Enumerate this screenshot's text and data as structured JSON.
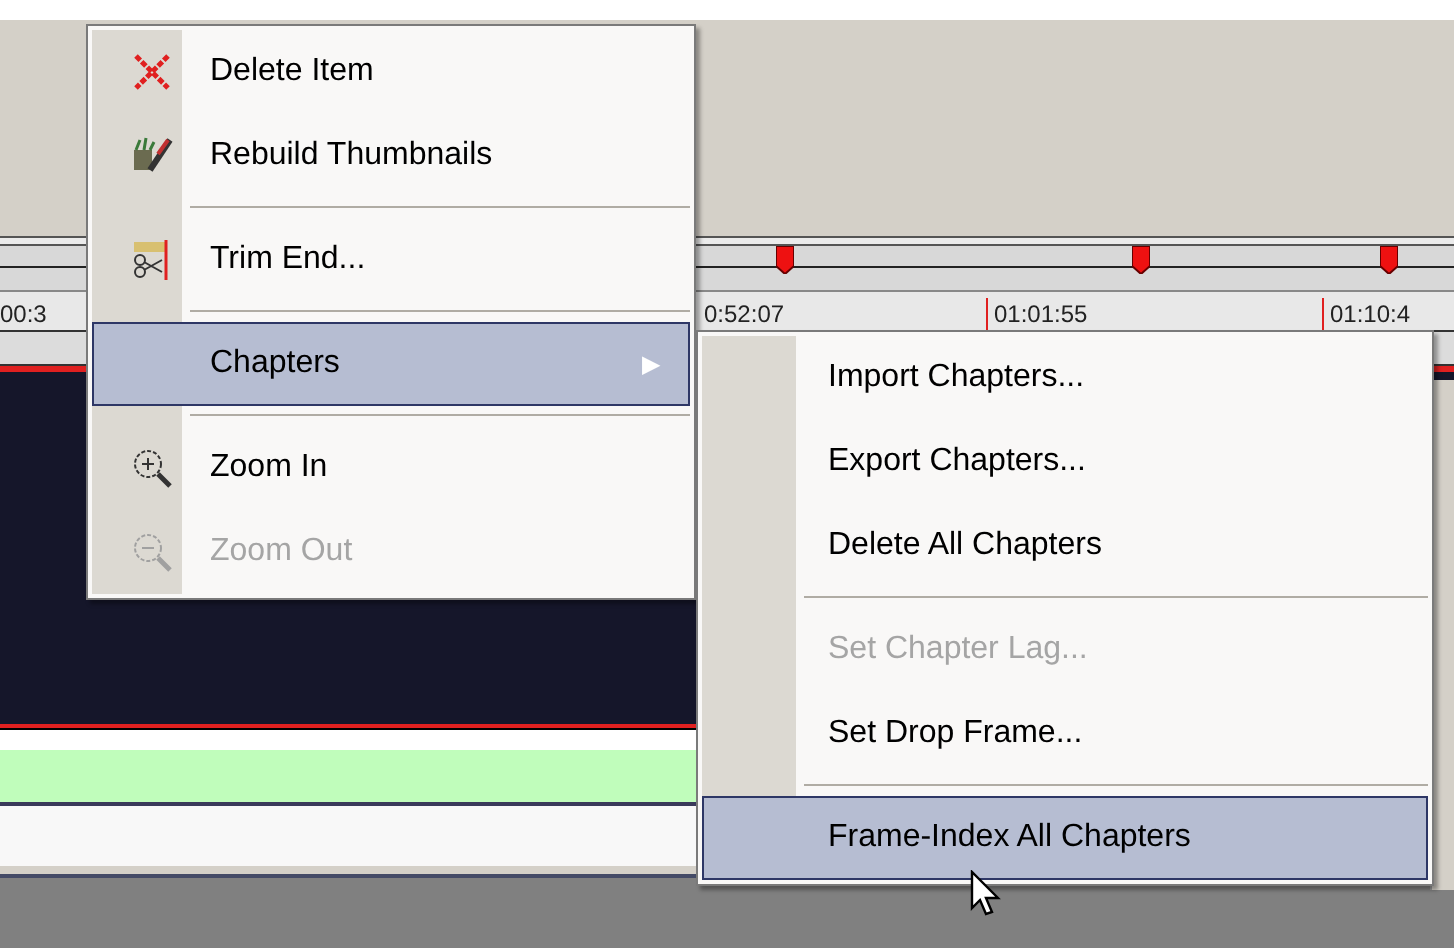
{
  "timeline": {
    "ruler_labels": [
      "00:3",
      "0:52:07",
      "01:01:55",
      "01:10:4"
    ]
  },
  "context_menu": {
    "items": [
      {
        "kind": "item",
        "label": "Delete Item",
        "disabled": false,
        "selected": false
      },
      {
        "kind": "item",
        "label": "Rebuild Thumbnails",
        "disabled": false,
        "selected": false
      },
      {
        "kind": "separator"
      },
      {
        "kind": "item",
        "label": "Trim End...",
        "disabled": false,
        "selected": false
      },
      {
        "kind": "separator"
      },
      {
        "kind": "submenu",
        "label": "Chapters",
        "arrow": "▶",
        "disabled": false,
        "selected": true
      },
      {
        "kind": "separator"
      },
      {
        "kind": "item",
        "label": "Zoom In",
        "disabled": false,
        "selected": false
      },
      {
        "kind": "item",
        "label": "Zoom Out",
        "disabled": true,
        "selected": false
      }
    ]
  },
  "submenu": {
    "items": [
      {
        "kind": "item",
        "label": "Import Chapters...",
        "disabled": false,
        "selected": false
      },
      {
        "kind": "item",
        "label": "Export Chapters...",
        "disabled": false,
        "selected": false
      },
      {
        "kind": "item",
        "label": "Delete All Chapters",
        "disabled": false,
        "selected": false
      },
      {
        "kind": "separator"
      },
      {
        "kind": "item",
        "label": "Set Chapter Lag...",
        "disabled": true,
        "selected": false
      },
      {
        "kind": "item",
        "label": "Set Drop Frame...",
        "disabled": false,
        "selected": false
      },
      {
        "kind": "separator"
      },
      {
        "kind": "item",
        "label": "Frame-Index All Chapters",
        "disabled": false,
        "selected": true
      }
    ]
  }
}
